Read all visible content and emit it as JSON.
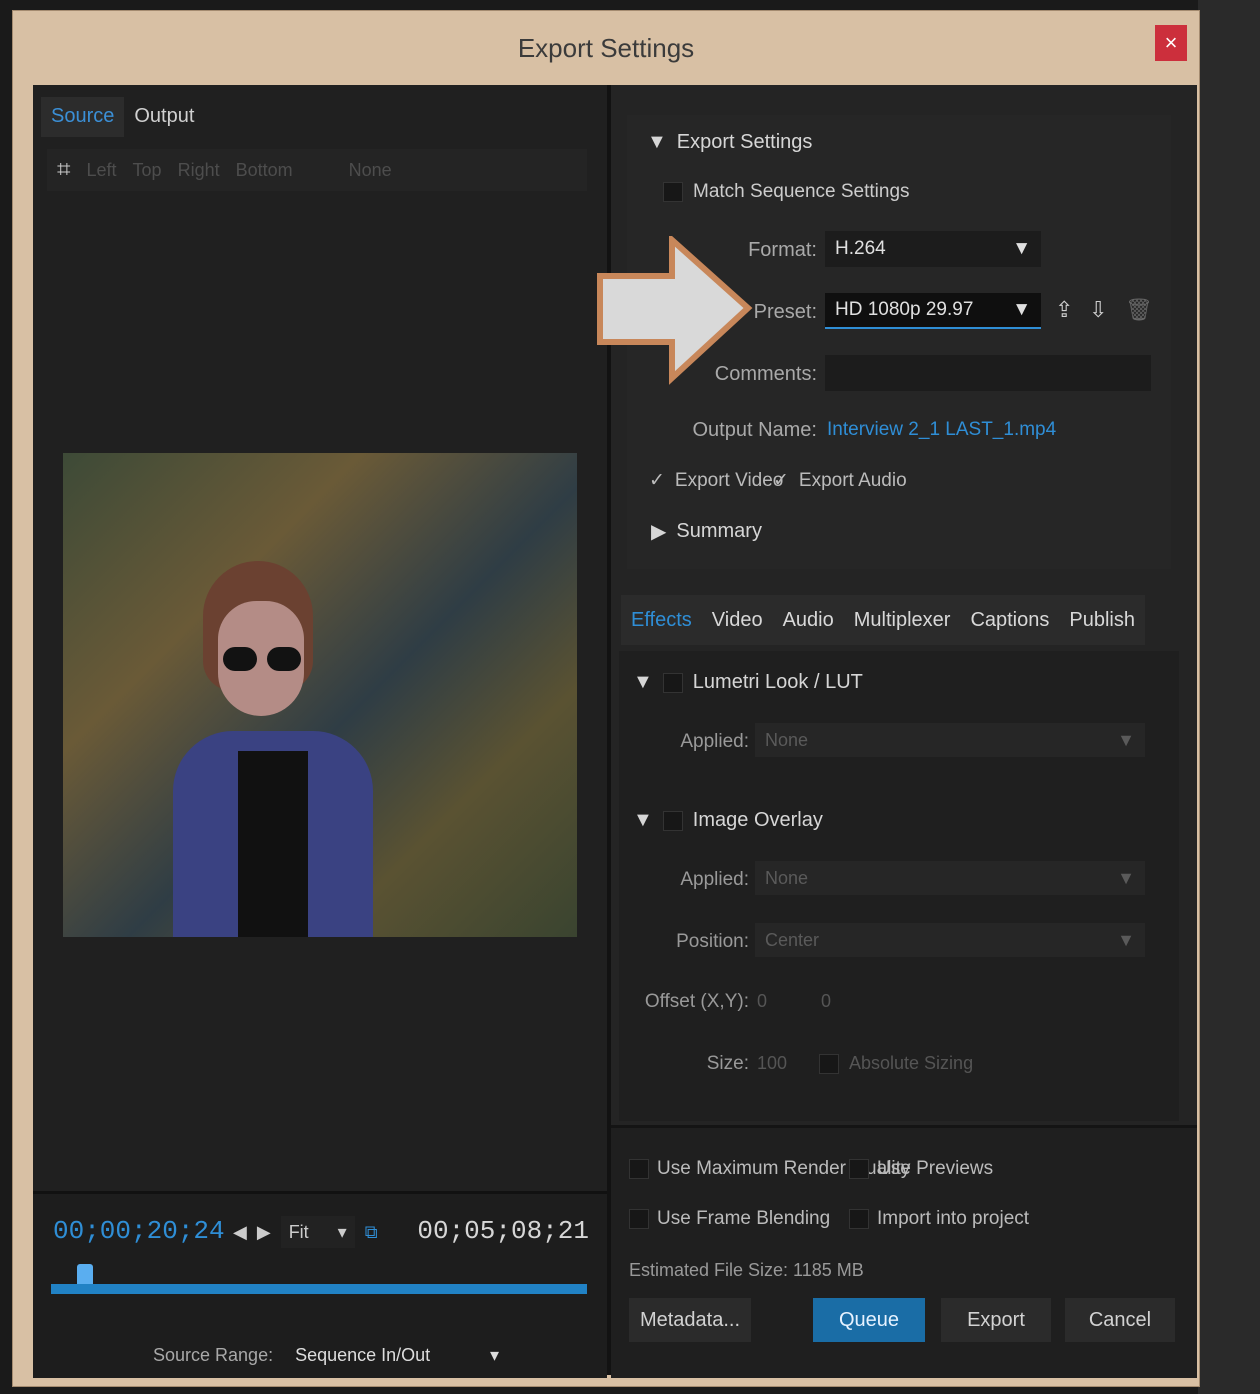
{
  "window": {
    "title": "Export Settings",
    "close_label": "×"
  },
  "left": {
    "tabs": [
      {
        "label": "Source"
      },
      {
        "label": "Output"
      }
    ],
    "crop": {
      "left": "Left",
      "top": "Top",
      "right": "Right",
      "bottom": "Bottom",
      "ratio": "None"
    },
    "timecode_in": "00;00;20;24",
    "timecode_out": "00;05;08;21",
    "fit": "Fit",
    "source_range_label": "Source Range:",
    "source_range_value": "Sequence In/Out"
  },
  "export": {
    "section_title": "Export Settings",
    "match_sequence": "Match Sequence Settings",
    "format_label": "Format:",
    "format_value": "H.264",
    "preset_label": "Preset:",
    "preset_value": "HD 1080p 29.97",
    "comments_label": "Comments:",
    "output_name_label": "Output Name:",
    "output_name_value": "Interview 2_1 LAST_1.mp4",
    "export_video": "Export Video",
    "export_audio": "Export Audio",
    "summary": "Summary"
  },
  "tabs": [
    {
      "label": "Effects"
    },
    {
      "label": "Video"
    },
    {
      "label": "Audio"
    },
    {
      "label": "Multiplexer"
    },
    {
      "label": "Captions"
    },
    {
      "label": "Publish"
    }
  ],
  "effects": {
    "lumetri_title": "Lumetri Look / LUT",
    "applied_label": "Applied:",
    "applied_value": "None",
    "overlay_title": "Image Overlay",
    "overlay_applied_label": "Applied:",
    "overlay_applied_value": "None",
    "position_label": "Position:",
    "position_value": "Center",
    "offset_label": "Offset (X,Y):",
    "offset_x": "0",
    "offset_y": "0",
    "size_label": "Size:",
    "size_value": "100",
    "absolute_sizing": "Absolute Sizing"
  },
  "footer": {
    "max_render": "Use Maximum Render Quality",
    "use_previews": "Use Previews",
    "frame_blending": "Use Frame Blending",
    "import_project": "Import into project",
    "file_size": "Estimated File Size:  1185 MB",
    "metadata": "Metadata...",
    "queue": "Queue",
    "export": "Export",
    "cancel": "Cancel"
  },
  "colors": {
    "accent": "#2f8ed6",
    "close": "#cc2f3c",
    "frame": "#d8c0a4"
  }
}
